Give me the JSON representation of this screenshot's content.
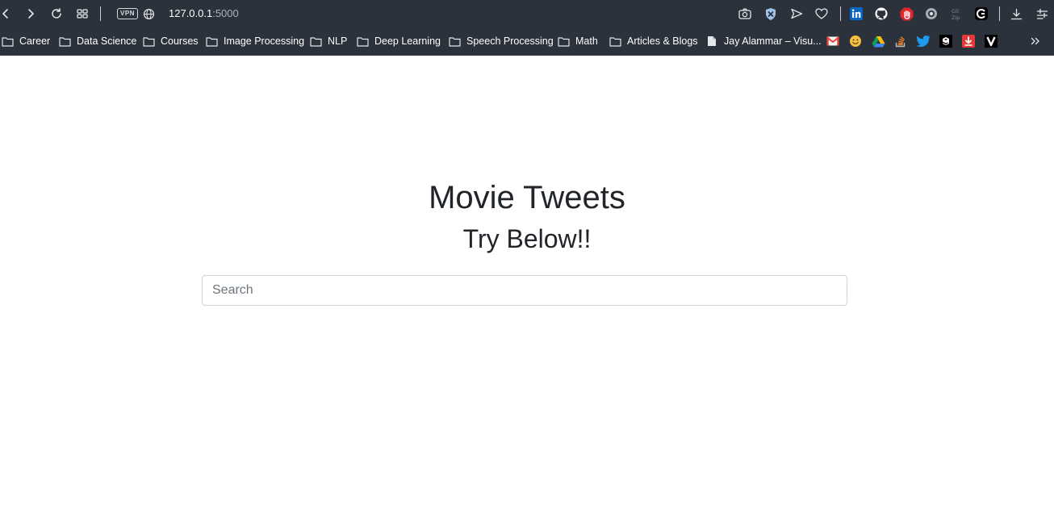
{
  "browser": {
    "address": {
      "host": "127.0.0.1",
      "port": ":5000"
    },
    "vpn_label": "VPN",
    "bookmarks": [
      {
        "label": "Career",
        "type": "folder"
      },
      {
        "label": "Data Science",
        "type": "folder"
      },
      {
        "label": "Courses",
        "type": "folder"
      },
      {
        "label": "Image Processing",
        "type": "folder"
      },
      {
        "label": "NLP",
        "type": "folder"
      },
      {
        "label": "Deep Learning",
        "type": "folder"
      },
      {
        "label": "Speech Processing",
        "type": "folder"
      },
      {
        "label": "Math",
        "type": "folder"
      },
      {
        "label": "Articles & Blogs",
        "type": "folder"
      },
      {
        "label": "Jay Alammar – Visu...",
        "type": "page"
      }
    ],
    "bookmark_favicons": [
      "gmail-icon",
      "emoji-icon",
      "google-drive-icon",
      "stackoverflow-icon",
      "twitter-icon",
      "nine-gag-icon",
      "download-icon",
      "v-icon"
    ],
    "extensions": [
      "camera-icon",
      "shield-icon",
      "send-icon",
      "heart-icon",
      "linkedin-icon",
      "github-icon",
      "stop-hand-icon",
      "record-icon",
      "gitzip-icon",
      "ring-icon",
      "download-icon",
      "menu-icon"
    ],
    "colors": {
      "chrome_bg": "#2b323b",
      "linkedin": "#0a66c2",
      "twitter": "#1d9bf0",
      "gmail": "#ea4335"
    }
  },
  "page": {
    "title": "Movie Tweets",
    "subtitle": "Try Below!!",
    "search": {
      "placeholder": "Search",
      "value": ""
    }
  }
}
